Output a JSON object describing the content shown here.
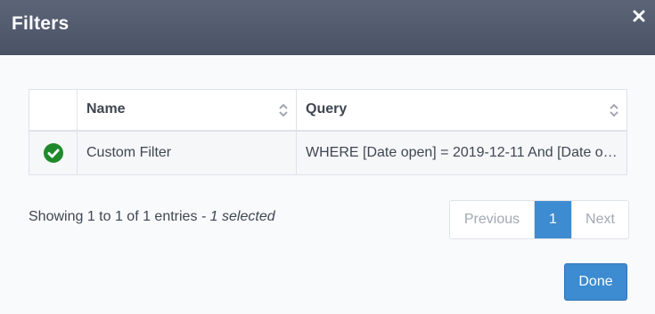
{
  "dialog": {
    "title": "Filters"
  },
  "table": {
    "headers": {
      "name": "Name",
      "query": "Query"
    },
    "rows": [
      {
        "selected": true,
        "name": "Custom Filter",
        "query": "WHERE [Date open] = 2019-12-11 And [Date o…"
      }
    ]
  },
  "info": {
    "showing": "Showing 1 to 1 of 1 entries",
    "selected": "- 1 selected"
  },
  "pagination": {
    "previous": "Previous",
    "current_page": "1",
    "next": "Next"
  },
  "footer": {
    "done_label": "Done"
  },
  "colors": {
    "header_bg": "#4f576b",
    "accent": "#3d8bd0",
    "check_green": "#1f8a2b"
  }
}
